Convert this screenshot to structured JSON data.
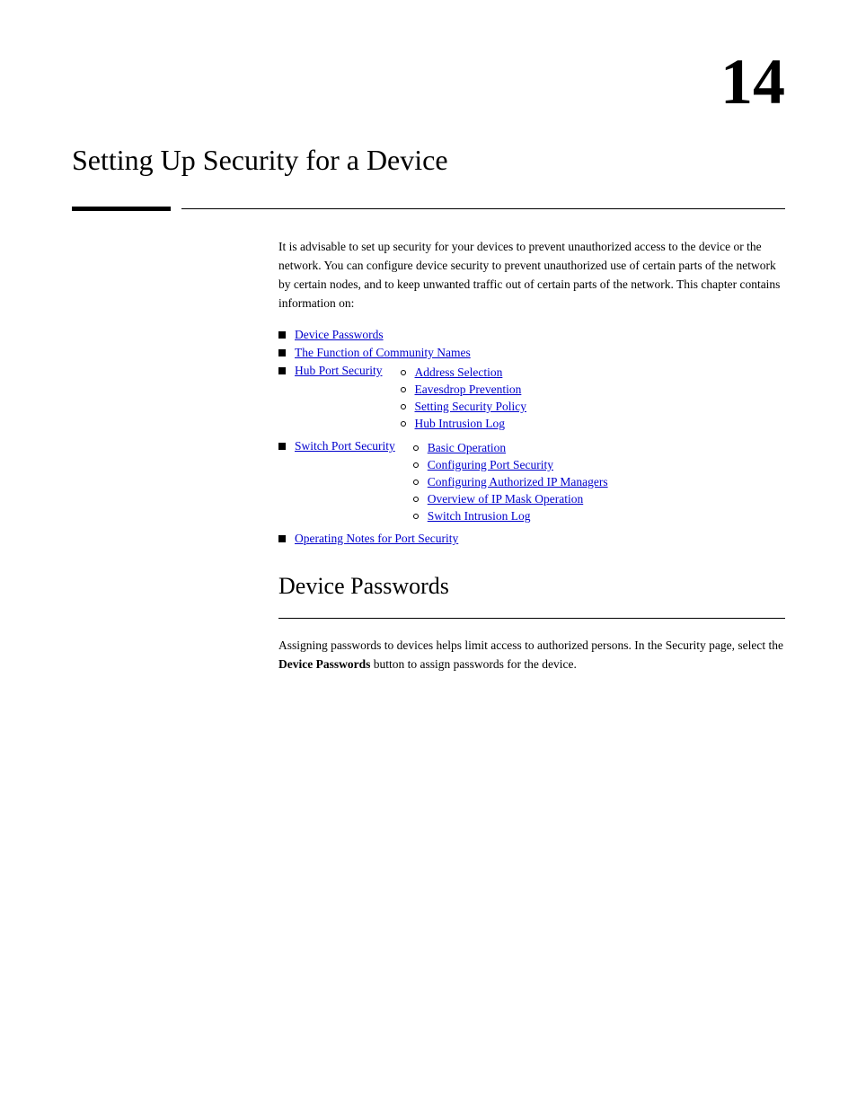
{
  "chapter": {
    "number": "14",
    "title": "Setting Up Security for a Device"
  },
  "intro": {
    "text": "It is advisable to set up security for your devices to prevent unauthorized access to the device or the network. You can configure device security to prevent unauthorized use of certain parts of the network by certain nodes, and to keep unwanted traffic out of certain parts of the network. This chapter contains information on:"
  },
  "toc": {
    "items": [
      {
        "label": "Device Passwords",
        "href": "#device-passwords",
        "sub": []
      },
      {
        "label": "The Function of Community Names",
        "href": "#community-names",
        "sub": []
      },
      {
        "label": "Hub Port Security",
        "href": "#hub-port-security",
        "sub": [
          {
            "label": "Address Selection",
            "href": "#address-selection"
          },
          {
            "label": "Eavesdrop Prevention",
            "href": "#eavesdrop-prevention"
          },
          {
            "label": "Setting Security Policy",
            "href": "#setting-security-policy"
          },
          {
            "label": "Hub Intrusion Log",
            "href": "#hub-intrusion-log"
          }
        ]
      },
      {
        "label": "Switch Port Security",
        "href": "#switch-port-security",
        "sub": [
          {
            "label": "Basic Operation",
            "href": "#basic-operation"
          },
          {
            "label": "Configuring Port Security",
            "href": "#configuring-port-security"
          },
          {
            "label": "Configuring Authorized IP Managers",
            "href": "#configuring-authorized-managers"
          },
          {
            "label": "Overview of IP Mask Operation",
            "href": "#ip-mask-operation"
          },
          {
            "label": "Switch Intrusion Log",
            "href": "#switch-intrusion-log"
          }
        ]
      },
      {
        "label": "Operating Notes for Port Security",
        "href": "#operating-notes",
        "sub": []
      }
    ]
  },
  "device_passwords": {
    "title": "Device Passwords",
    "text": "Assigning passwords to devices helps limit access to authorized persons. In the Security page, select the ",
    "bold": "Device Passwords",
    "text2": " button to assign passwords for the device."
  }
}
